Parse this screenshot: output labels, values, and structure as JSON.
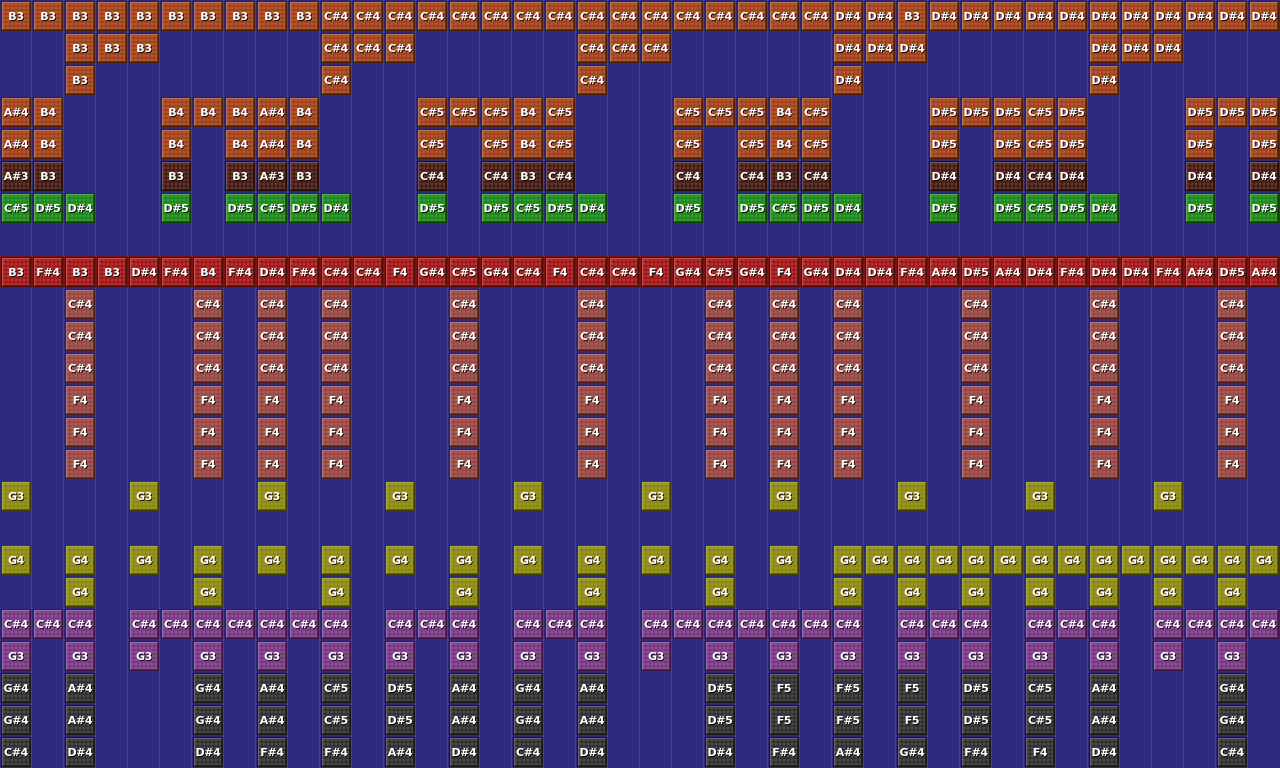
{
  "palette": {
    "orange": "#a4441c",
    "darkbrown": "#4a1e16",
    "green": "#1f8c1a",
    "red": "#a51a1a",
    "rose": "#9a4846",
    "olive": "#8f8a10",
    "purple": "#7a3a86",
    "darkgray": "#333333",
    "background": "#2e2a7e"
  },
  "rows": [
    {
      "color": "orange",
      "cells": [
        "B3",
        "B3",
        "B3",
        "B3",
        "B3",
        "B3",
        "B3",
        "B3",
        "B3",
        "B3",
        "C#4",
        "C#4",
        "C#4",
        "C#4",
        "C#4",
        "C#4",
        "C#4",
        "C#4",
        "C#4",
        "C#4",
        "C#4",
        "C#4",
        "C#4",
        "C#4",
        "C#4",
        "C#4",
        "D#4",
        "D#4",
        "B3",
        "D#4",
        "D#4",
        "D#4",
        "D#4",
        "D#4",
        "D#4",
        "D#4",
        "D#4",
        "D#4",
        "D#4",
        "D#4"
      ]
    },
    {
      "color": "orange",
      "cells": [
        "",
        "",
        "B3",
        "B3",
        "B3",
        "",
        "",
        "",
        "",
        "",
        "C#4",
        "C#4",
        "C#4",
        "",
        "",
        "",
        "",
        "",
        "C#4",
        "C#4",
        "C#4",
        "",
        "",
        "",
        "",
        "",
        "D#4",
        "D#4",
        "D#4",
        "",
        "",
        "",
        "",
        "",
        "D#4",
        "D#4",
        "D#4",
        "",
        "",
        ""
      ]
    },
    {
      "color": "orange",
      "cells": [
        "",
        "",
        "B3",
        "",
        "",
        "",
        "",
        "",
        "",
        "",
        "C#4",
        "",
        "",
        "",
        "",
        "",
        "",
        "",
        "C#4",
        "",
        "",
        "",
        "",
        "",
        "",
        "",
        "D#4",
        "",
        "",
        "",
        "",
        "",
        "",
        "",
        "D#4",
        "",
        "",
        "",
        "",
        ""
      ]
    },
    {
      "color": "orange",
      "cells": [
        "A#4",
        "B4",
        "",
        "",
        "",
        "B4",
        "B4",
        "B4",
        "A#4",
        "B4",
        "",
        "",
        "",
        "C#5",
        "C#5",
        "C#5",
        "B4",
        "C#5",
        "",
        "",
        "",
        "C#5",
        "C#5",
        "C#5",
        "B4",
        "C#5",
        "",
        "",
        "",
        "D#5",
        "D#5",
        "D#5",
        "C#5",
        "D#5",
        "",
        "",
        "",
        "D#5",
        "D#5",
        "D#5"
      ]
    },
    {
      "color": "orange",
      "cells": [
        "A#4",
        "B4",
        "",
        "",
        "",
        "B4",
        "",
        "B4",
        "A#4",
        "B4",
        "",
        "",
        "",
        "C#5",
        "",
        "C#5",
        "B4",
        "C#5",
        "",
        "",
        "",
        "C#5",
        "",
        "C#5",
        "B4",
        "C#5",
        "",
        "",
        "",
        "D#5",
        "",
        "D#5",
        "C#5",
        "D#5",
        "",
        "",
        "",
        "D#5",
        "",
        "D#5"
      ]
    },
    {
      "color": "darkbrown",
      "cells": [
        "A#3",
        "B3",
        "",
        "",
        "",
        "B3",
        "",
        "B3",
        "A#3",
        "B3",
        "",
        "",
        "",
        "C#4",
        "",
        "C#4",
        "B3",
        "C#4",
        "",
        "",
        "",
        "C#4",
        "",
        "C#4",
        "B3",
        "C#4",
        "",
        "",
        "",
        "D#4",
        "",
        "D#4",
        "C#4",
        "D#4",
        "",
        "",
        "",
        "D#4",
        "",
        "D#4"
      ]
    },
    {
      "color": "green",
      "cells": [
        "C#5",
        "D#5",
        "D#4",
        "",
        "",
        "D#5",
        "",
        "D#5",
        "C#5",
        "D#5",
        "D#4",
        "",
        "",
        "D#5",
        "",
        "D#5",
        "C#5",
        "D#5",
        "D#4",
        "",
        "",
        "D#5",
        "",
        "D#5",
        "C#5",
        "D#5",
        "D#4",
        "",
        "",
        "D#5",
        "",
        "D#5",
        "C#5",
        "D#5",
        "D#4",
        "",
        "",
        "D#5",
        "",
        "D#5"
      ]
    },
    {
      "color": "",
      "cells": []
    },
    {
      "color": "red",
      "cells": [
        "B3",
        "F#4",
        "B3",
        "B3",
        "D#4",
        "F#4",
        "B4",
        "F#4",
        "D#4",
        "F#4",
        "C#4",
        "C#4",
        "F4",
        "G#4",
        "C#5",
        "G#4",
        "C#4",
        "F4",
        "C#4",
        "C#4",
        "F4",
        "G#4",
        "C#5",
        "G#4",
        "F4",
        "G#4",
        "D#4",
        "D#4",
        "F#4",
        "A#4",
        "D#5",
        "A#4",
        "D#4",
        "F#4",
        "D#4",
        "D#4",
        "F#4",
        "A#4",
        "D#5",
        "A#4"
      ]
    },
    {
      "color": "rose",
      "cells": [
        "",
        "",
        "C#4",
        "",
        "",
        "",
        "C#4",
        "",
        "C#4",
        "",
        "C#4",
        "",
        "",
        "",
        "C#4",
        "",
        "",
        "",
        "C#4",
        "",
        "",
        "",
        "C#4",
        "",
        "C#4",
        "",
        "C#4",
        "",
        "",
        "",
        "C#4",
        "",
        "",
        "",
        "C#4",
        "",
        "",
        "",
        "C#4",
        ""
      ]
    },
    {
      "color": "rose",
      "cells": [
        "",
        "",
        "C#4",
        "",
        "",
        "",
        "C#4",
        "",
        "C#4",
        "",
        "C#4",
        "",
        "",
        "",
        "C#4",
        "",
        "",
        "",
        "C#4",
        "",
        "",
        "",
        "C#4",
        "",
        "C#4",
        "",
        "C#4",
        "",
        "",
        "",
        "C#4",
        "",
        "",
        "",
        "C#4",
        "",
        "",
        "",
        "C#4",
        ""
      ]
    },
    {
      "color": "rose",
      "cells": [
        "",
        "",
        "C#4",
        "",
        "",
        "",
        "C#4",
        "",
        "C#4",
        "",
        "C#4",
        "",
        "",
        "",
        "C#4",
        "",
        "",
        "",
        "C#4",
        "",
        "",
        "",
        "C#4",
        "",
        "C#4",
        "",
        "C#4",
        "",
        "",
        "",
        "C#4",
        "",
        "",
        "",
        "C#4",
        "",
        "",
        "",
        "C#4",
        ""
      ]
    },
    {
      "color": "rose",
      "cells": [
        "",
        "",
        "F4",
        "",
        "",
        "",
        "F4",
        "",
        "F4",
        "",
        "F4",
        "",
        "",
        "",
        "F4",
        "",
        "",
        "",
        "F4",
        "",
        "",
        "",
        "F4",
        "",
        "F4",
        "",
        "F4",
        "",
        "",
        "",
        "F4",
        "",
        "",
        "",
        "F4",
        "",
        "",
        "",
        "F4",
        ""
      ]
    },
    {
      "color": "rose",
      "cells": [
        "",
        "",
        "F4",
        "",
        "",
        "",
        "F4",
        "",
        "F4",
        "",
        "F4",
        "",
        "",
        "",
        "F4",
        "",
        "",
        "",
        "F4",
        "",
        "",
        "",
        "F4",
        "",
        "F4",
        "",
        "F4",
        "",
        "",
        "",
        "F4",
        "",
        "",
        "",
        "F4",
        "",
        "",
        "",
        "F4",
        ""
      ]
    },
    {
      "color": "rose",
      "cells": [
        "",
        "",
        "F4",
        "",
        "",
        "",
        "F4",
        "",
        "F4",
        "",
        "F4",
        "",
        "",
        "",
        "F4",
        "",
        "",
        "",
        "F4",
        "",
        "",
        "",
        "F4",
        "",
        "F4",
        "",
        "F4",
        "",
        "",
        "",
        "F4",
        "",
        "",
        "",
        "F4",
        "",
        "",
        "",
        "F4",
        ""
      ]
    },
    {
      "color": "olive",
      "cells": [
        "G3",
        "",
        "",
        "",
        "G3",
        "",
        "",
        "",
        "G3",
        "",
        "",
        "",
        "G3",
        "",
        "",
        "",
        "G3",
        "",
        "",
        "",
        "G3",
        "",
        "",
        "",
        "G3",
        "",
        "",
        "",
        "G3",
        "",
        "",
        "",
        "G3",
        "",
        "",
        "",
        "G3",
        "",
        "",
        ""
      ]
    },
    {
      "color": "",
      "cells": []
    },
    {
      "color": "olive",
      "cells": [
        "G4",
        "",
        "G4",
        "",
        "G4",
        "",
        "G4",
        "",
        "G4",
        "",
        "G4",
        "",
        "G4",
        "",
        "G4",
        "",
        "G4",
        "",
        "G4",
        "",
        "G4",
        "",
        "G4",
        "",
        "G4",
        "",
        "G4",
        "G4",
        "G4",
        "G4",
        "G4",
        "G4",
        "G4",
        "G4",
        "G4",
        "G4",
        "G4",
        "G4",
        "G4",
        "G4"
      ]
    },
    {
      "color": "olive",
      "cells": [
        "",
        "",
        "G4",
        "",
        "",
        "",
        "G4",
        "",
        "",
        "",
        "G4",
        "",
        "",
        "",
        "G4",
        "",
        "",
        "",
        "G4",
        "",
        "",
        "",
        "G4",
        "",
        "",
        "",
        "G4",
        "",
        "G4",
        "",
        "G4",
        "",
        "G4",
        "",
        "G4",
        "",
        "G4",
        "",
        "G4",
        ""
      ]
    },
    {
      "color": "purple",
      "cells": [
        "C#4",
        "C#4",
        "C#4",
        "",
        "C#4",
        "C#4",
        "C#4",
        "C#4",
        "C#4",
        "C#4",
        "C#4",
        "",
        "C#4",
        "C#4",
        "C#4",
        "",
        "C#4",
        "C#4",
        "C#4",
        "",
        "C#4",
        "C#4",
        "C#4",
        "C#4",
        "C#4",
        "C#4",
        "C#4",
        "",
        "C#4",
        "C#4",
        "C#4",
        "",
        "C#4",
        "C#4",
        "C#4",
        "",
        "C#4",
        "C#4",
        "C#4",
        "C#4"
      ]
    },
    {
      "color": "purple",
      "cells": [
        "G3",
        "",
        "G3",
        "",
        "G3",
        "",
        "G3",
        "",
        "G3",
        "",
        "G3",
        "",
        "G3",
        "",
        "G3",
        "",
        "G3",
        "",
        "G3",
        "",
        "G3",
        "",
        "G3",
        "",
        "G3",
        "",
        "G3",
        "",
        "G3",
        "",
        "G3",
        "",
        "G3",
        "",
        "G3",
        "",
        "G3",
        "",
        "G3",
        ""
      ]
    },
    {
      "color": "darkgray",
      "cells": [
        "G#4",
        "",
        "A#4",
        "",
        "",
        "",
        "G#4",
        "",
        "A#4",
        "",
        "C#5",
        "",
        "D#5",
        "",
        "A#4",
        "",
        "G#4",
        "",
        "A#4",
        "",
        "",
        "",
        "D#5",
        "",
        "F5",
        "",
        "F#5",
        "",
        "F5",
        "",
        "D#5",
        "",
        "C#5",
        "",
        "A#4",
        "",
        "",
        "",
        "G#4",
        ""
      ]
    },
    {
      "color": "darkgray",
      "cells": [
        "G#4",
        "",
        "A#4",
        "",
        "",
        "",
        "G#4",
        "",
        "A#4",
        "",
        "C#5",
        "",
        "D#5",
        "",
        "A#4",
        "",
        "G#4",
        "",
        "A#4",
        "",
        "",
        "",
        "D#5",
        "",
        "F5",
        "",
        "F#5",
        "",
        "F5",
        "",
        "D#5",
        "",
        "C#5",
        "",
        "A#4",
        "",
        "",
        "",
        "G#4",
        ""
      ]
    },
    {
      "color": "darkgray",
      "cells": [
        "C#4",
        "",
        "D#4",
        "",
        "",
        "",
        "D#4",
        "",
        "F#4",
        "",
        "F#4",
        "",
        "A#4",
        "",
        "D#4",
        "",
        "C#4",
        "",
        "D#4",
        "",
        "",
        "",
        "D#4",
        "",
        "F#4",
        "",
        "A#4",
        "",
        "G#4",
        "",
        "F#4",
        "",
        "F4",
        "",
        "D#4",
        "",
        "",
        "",
        "C#4",
        ""
      ]
    }
  ]
}
